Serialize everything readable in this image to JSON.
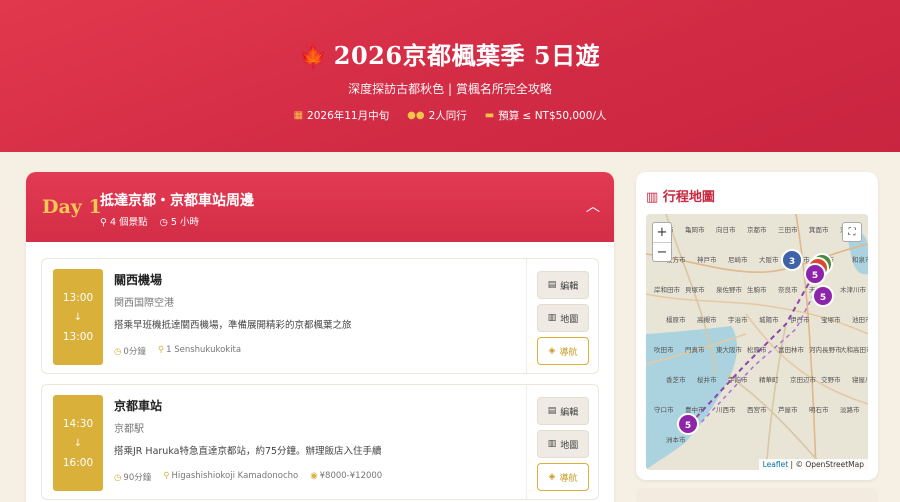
{
  "header": {
    "title": "2026京都楓葉季 5日遊",
    "subtitle": "深度探訪古都秋色 | 賞楓名所完全攻略",
    "meta": [
      {
        "icon": "calendar-icon",
        "text": "2026年11月中旬"
      },
      {
        "icon": "people-icon",
        "text": "2人同行"
      },
      {
        "icon": "wallet-icon",
        "text": "預算 ≤ NT$50,000/人"
      }
    ]
  },
  "day": {
    "label": "Day 1",
    "title": "抵達京都・京都車站周邊",
    "spots": "4 個景點",
    "hours": "5 小時",
    "stops": [
      {
        "start": "13:00",
        "end": "13:00",
        "name": "關西機場",
        "jp": "関西国際空港",
        "desc": "搭乘早班機抵達關西機場，準備展開精彩的京都楓葉之旅",
        "duration": "0分鐘",
        "address": "1 Senshukukokita",
        "price": ""
      },
      {
        "start": "14:30",
        "end": "16:00",
        "name": "京都車站",
        "jp": "京都駅",
        "desc": "搭乘JR Haruka特急直達京都站，約75分鐘。辦理飯店入住手續",
        "duration": "90分鐘",
        "address": "Higashishiokoji Kamadonocho",
        "price": "¥8000-¥12000"
      }
    ],
    "actions": {
      "edit": "編輯",
      "map": "地圖",
      "nav": "導航"
    },
    "arrow": "↓"
  },
  "map": {
    "title": "行程地圖",
    "zoom_in": "+",
    "zoom_out": "−",
    "attribution_leaflet": "Leaflet",
    "attribution_rest": "| © OpenStreetMap",
    "clusters": [
      "3",
      "5",
      "5",
      "5"
    ],
    "labels": [
      "南丹市",
      "亀岡市",
      "向日市",
      "京都市",
      "三田市",
      "箕面市",
      "茨木市",
      "枚方市",
      "神戸市",
      "尼崎市",
      "大阪市",
      "八尾市",
      "堺市",
      "和泉市",
      "岸和田市",
      "貝塚市",
      "泉佐野市",
      "生駒市",
      "奈良市",
      "天理市",
      "木津川市",
      "橿原市",
      "高槻市",
      "宇治市",
      "城陽市",
      "伊丹市",
      "宝塚市",
      "池田市",
      "吹田市",
      "門真市",
      "東大阪市",
      "松原市",
      "富田林市",
      "河内長野市",
      "大和高田市",
      "香芝市",
      "桜井市",
      "宇陀市",
      "精華町",
      "京田辺市",
      "交野市",
      "寝屋川市",
      "守口市",
      "豊中市",
      "川西市",
      "西宮市",
      "芦屋市",
      "明石市",
      "淡路市",
      "洲本市"
    ],
    "colors": {
      "route": "#8e44ad",
      "cluster_purple": "#8e24aa",
      "cluster_blue": "#3f63a8"
    }
  }
}
